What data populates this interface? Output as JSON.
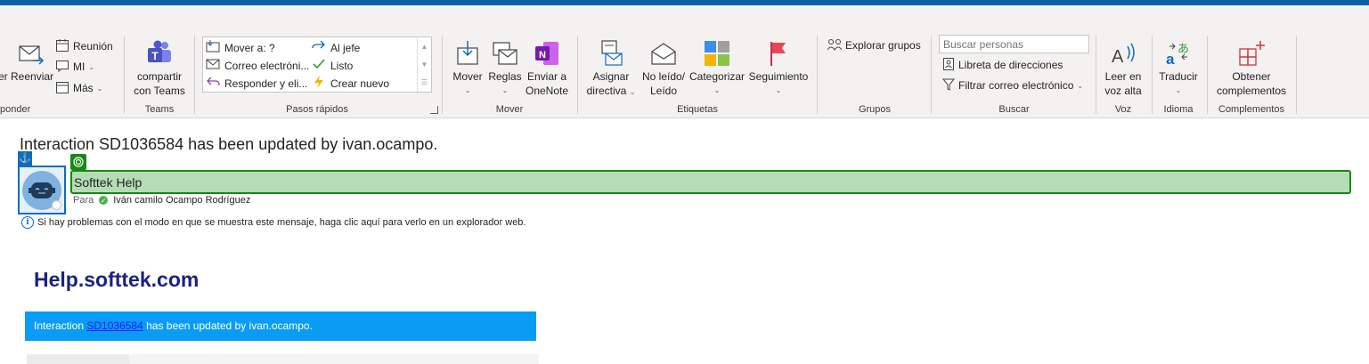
{
  "ribbon": {
    "groups": {
      "responder": "ponder",
      "teams": "Teams",
      "pasos_rapidos": "Pasos rápidos",
      "mover": "Mover",
      "etiquetas": "Etiquetas",
      "grupos": "Grupos",
      "buscar": "Buscar",
      "voz": "Voz",
      "idioma": "Idioma",
      "complementos": "Complementos"
    },
    "responder": {
      "partial_label": "er",
      "reenviar": "Reenviar",
      "reunion": "Reunión",
      "mi": "MI",
      "mas": "Más"
    },
    "teams": {
      "line1": "compartir",
      "line2": "con Teams"
    },
    "quick_steps": {
      "mover_a": "Mover a: ?",
      "correo": "Correo electróni...",
      "responder": "Responder y eli...",
      "al_jefe": "Al jefe",
      "listo": "Listo",
      "crear_nuevo": "Crear nuevo"
    },
    "move": {
      "mover": "Mover",
      "reglas": "Reglas",
      "onenote_line1": "Enviar a",
      "onenote_line2": "OneNote"
    },
    "tags": {
      "asignar_line1": "Asignar",
      "asignar_line2": "directiva",
      "noleido_line1": "No leído/",
      "noleido_line2": "Leído",
      "categorizar": "Categorizar",
      "seguimiento": "Seguimiento"
    },
    "groups_btn": {
      "explorar": "Explorar grupos"
    },
    "find": {
      "search_placeholder": "Buscar personas",
      "libreta": "Libreta de direcciones",
      "filtrar": "Filtrar correo electrónico"
    },
    "speech": {
      "line1": "Leer en",
      "line2": "voz alta"
    },
    "language": {
      "traducir": "Traducir"
    },
    "addins": {
      "line1": "Obtener",
      "line2": "complementos"
    }
  },
  "message": {
    "subject": "Interaction SD1036584 has been updated by ivan.ocampo.",
    "sender": "Softtek Help",
    "to_label": "Para",
    "to_name": "Iván camilo Ocampo Rodríguez",
    "info_text": "Si hay problemas con el modo en que se muestra este mensaje, haga clic aquí para verlo en un explorador web."
  },
  "body": {
    "title": "Help.softtek.com",
    "banner_prefix": "Interaction ",
    "banner_link": "SD1036584",
    "banner_suffix": " has been updated by ivan.ocampo."
  },
  "colors": {
    "topbar": "#0f5ea8",
    "sender_highlight": "#b4ddb4",
    "sender_border": "#138a13",
    "banner": "#0a9cf5",
    "title": "#1a237e"
  }
}
